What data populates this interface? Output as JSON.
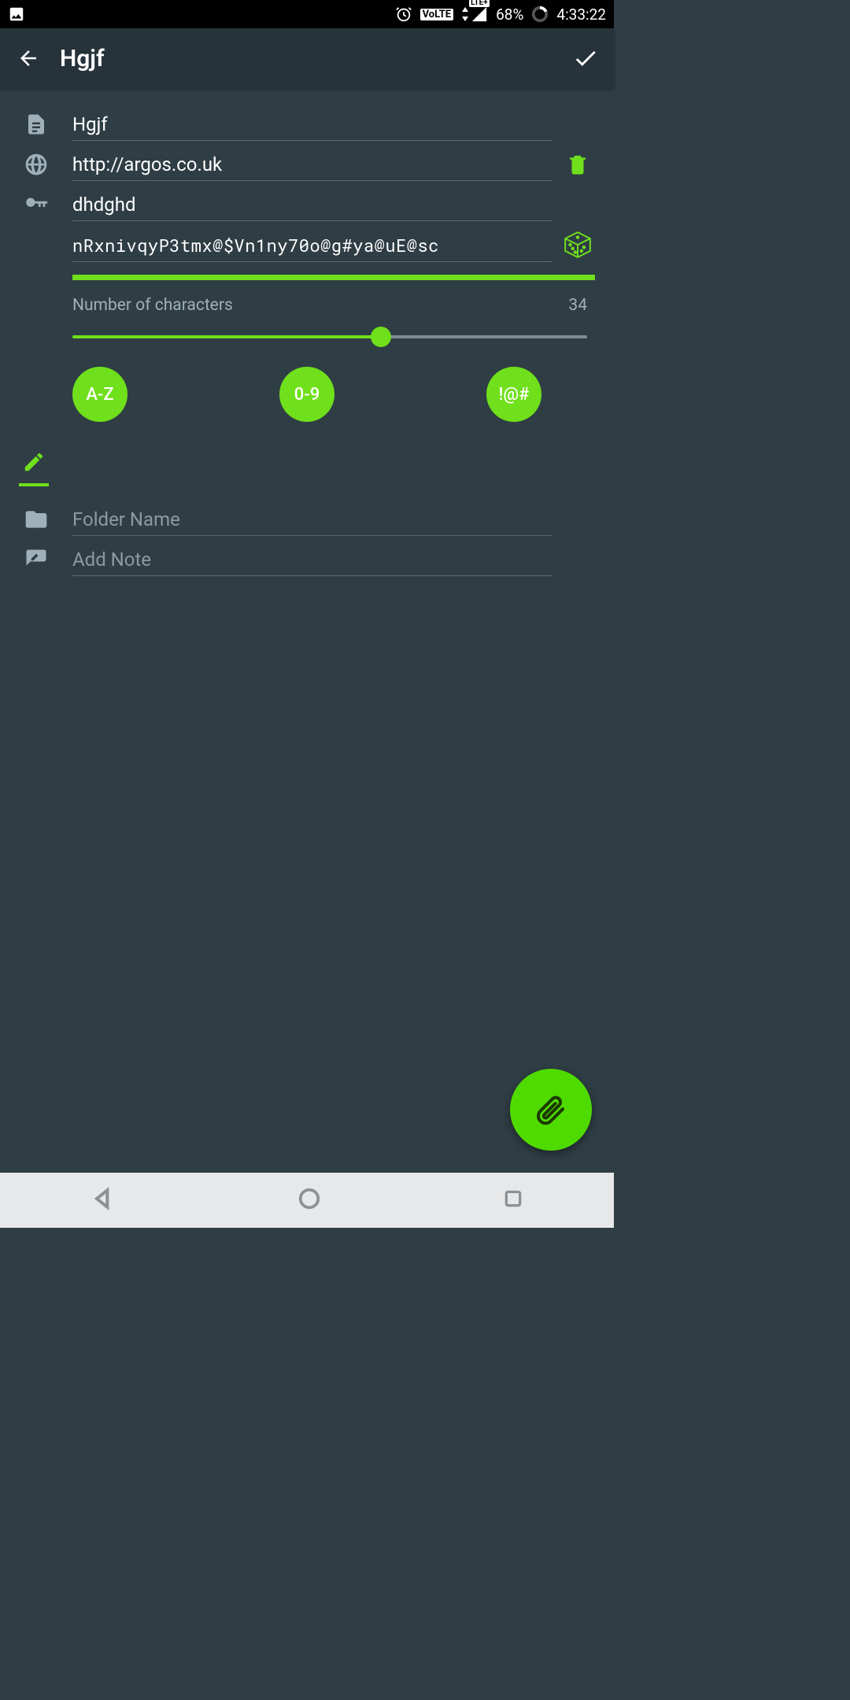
{
  "colors": {
    "accent": "#6fe01b",
    "bg": "#2f3d44",
    "appbar": "#27333a"
  },
  "statusbar": {
    "volte": "VoLTE",
    "lte": "LTE+",
    "battery_pct": "68%",
    "time": "4:33:22"
  },
  "header": {
    "title": "Hgjf"
  },
  "fields": {
    "title_value": "Hgjf",
    "url_value": "http://argos.co.uk",
    "username_value": "dhdghd",
    "password_value": "nRxnivqyP3tmx@$Vn1ny70o@g#ya@uE@sc",
    "folder_placeholder": "Folder Name",
    "note_placeholder": "Add Note"
  },
  "password_gen": {
    "label": "Number of characters",
    "value": "34",
    "slider_percent": 60,
    "chips": {
      "az": "A-Z",
      "num": "0-9",
      "sym": "!@#"
    }
  }
}
